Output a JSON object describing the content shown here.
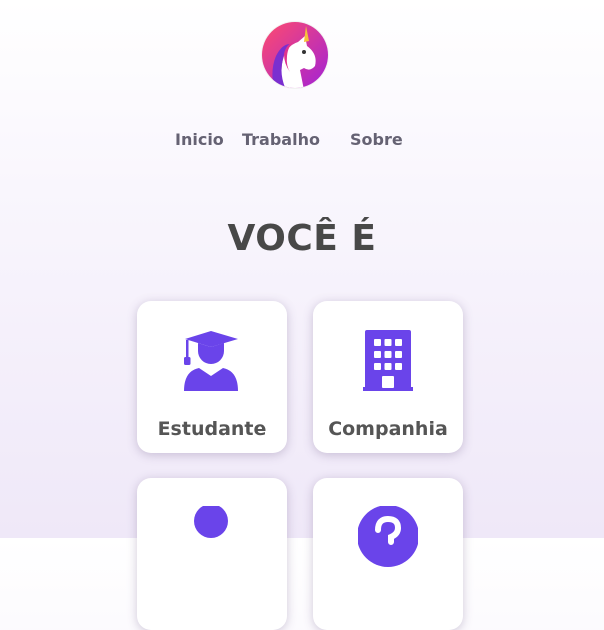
{
  "nav": {
    "inicio": "Inicio",
    "trabalho": "Trabalho",
    "sobre": "Sobre"
  },
  "title": "VOCÊ É",
  "cards": [
    {
      "label": "Estudante",
      "icon": "graduation-cap-icon"
    },
    {
      "label": "Companhia",
      "icon": "building-icon"
    },
    {
      "label": "",
      "icon": "person-icon"
    },
    {
      "label": "",
      "icon": "question-icon"
    }
  ],
  "colors": {
    "accent": "#6a44ea",
    "text": "#555555",
    "nav_text": "#656273",
    "title": "#484848",
    "logo_gradient_start": "#ff4b6e",
    "logo_gradient_end": "#a222d6"
  }
}
